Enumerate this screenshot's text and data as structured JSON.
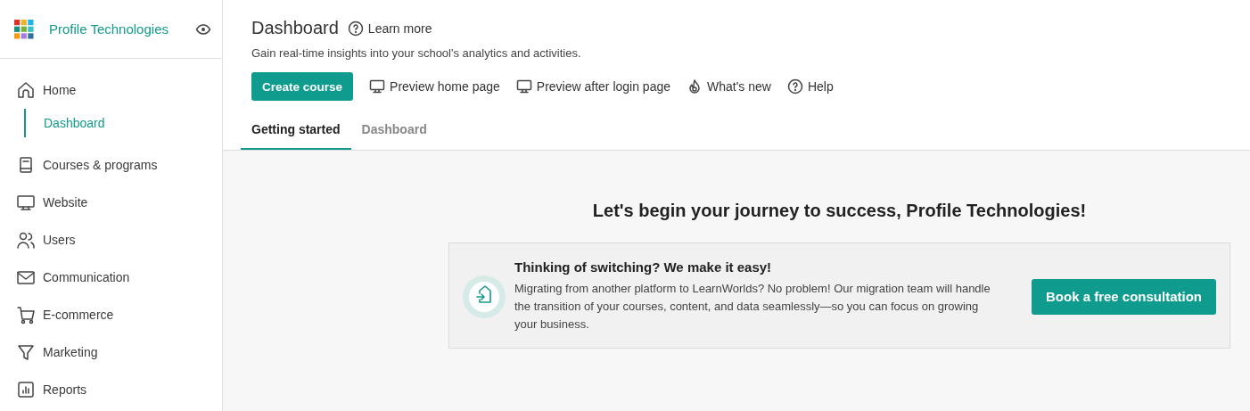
{
  "sidebar": {
    "brand": "Profile Technologies",
    "items": [
      {
        "label": "Home",
        "selected": false,
        "children": [
          {
            "label": "Dashboard",
            "selected": true
          }
        ]
      },
      {
        "label": "Courses & programs",
        "selected": false
      },
      {
        "label": "Website",
        "selected": false
      },
      {
        "label": "Users",
        "selected": false
      },
      {
        "label": "Communication",
        "selected": false
      },
      {
        "label": "E-commerce",
        "selected": false
      },
      {
        "label": "Marketing",
        "selected": false
      },
      {
        "label": "Reports",
        "selected": false
      }
    ]
  },
  "header": {
    "title": "Dashboard",
    "learn_more": "Learn more",
    "subtitle": "Gain real-time insights into your school's analytics and activities.",
    "actions": [
      {
        "kind": "primary",
        "label": "Create course"
      },
      {
        "kind": "link",
        "label": "Preview home page"
      },
      {
        "kind": "link",
        "label": "Preview after login page"
      },
      {
        "kind": "link",
        "label": "What's new"
      },
      {
        "kind": "link",
        "label": "Help"
      }
    ],
    "tabs": [
      {
        "label": "Getting started",
        "selected": true
      },
      {
        "label": "Dashboard",
        "selected": false
      }
    ]
  },
  "content": {
    "heading": "Let's begin your journey to success, Profile Technologies!",
    "banner": {
      "title": "Thinking of switching? We make it easy!",
      "text": "Migrating from another platform to LearnWorlds? No problem! Our migration team will handle the transition of your courses, content, and data seamlessly—so you can focus on growing your business.",
      "button": "Book a free consultation"
    }
  }
}
